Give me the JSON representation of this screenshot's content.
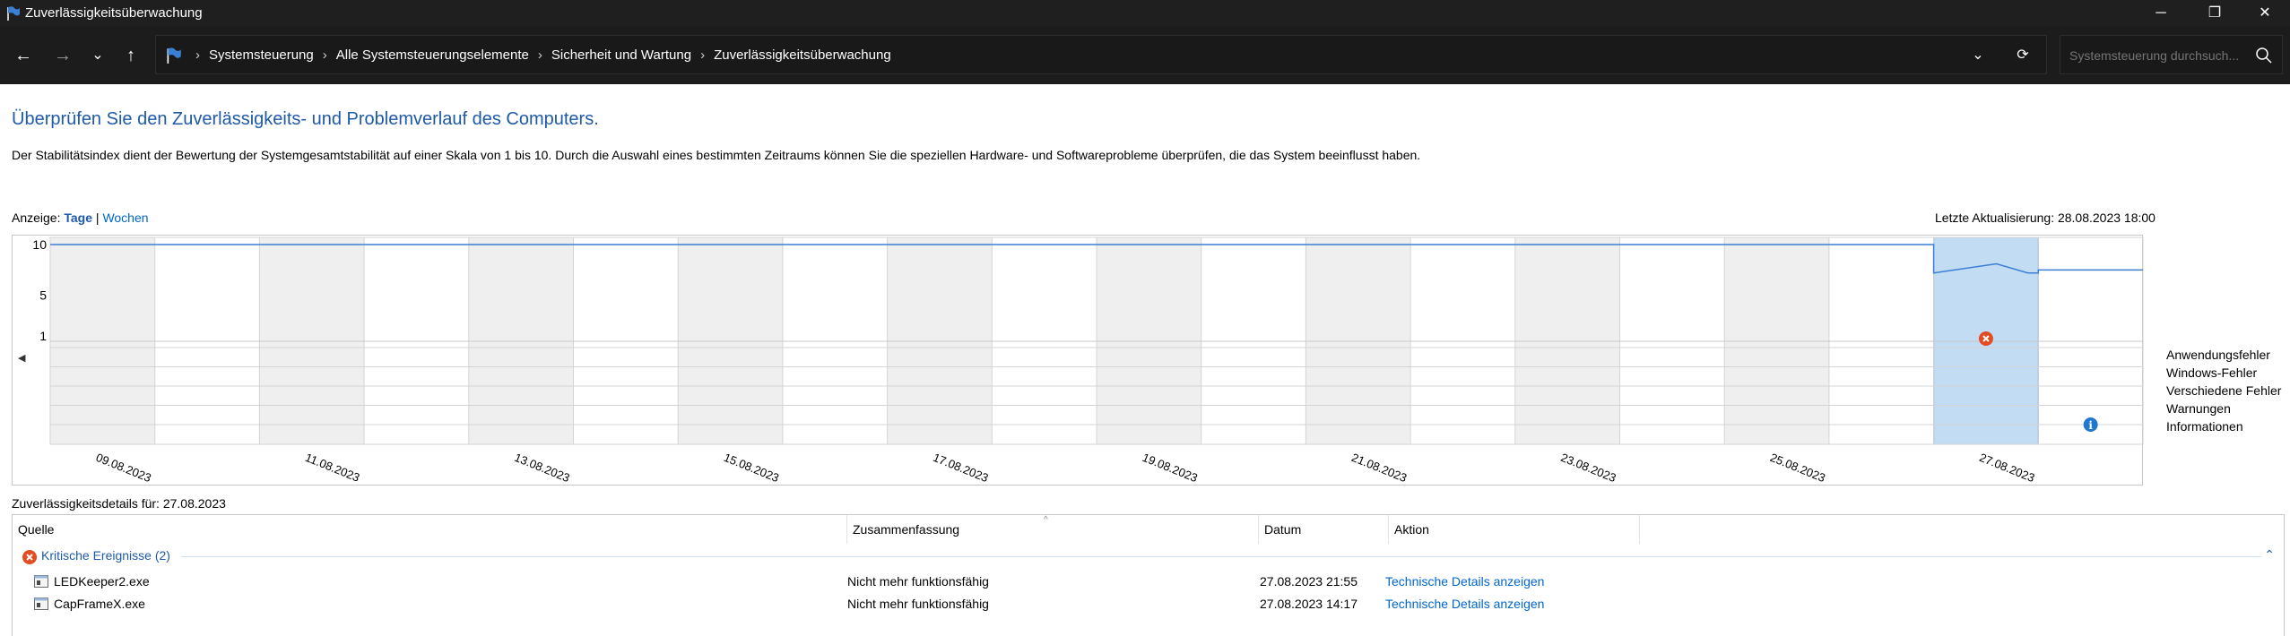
{
  "window": {
    "title": "Zuverlässigkeitsüberwachung",
    "controls": {
      "minimize": "─",
      "restore": "❐",
      "close": "✕"
    }
  },
  "nav": {
    "back": "←",
    "forward": "→",
    "recent": "⌄",
    "up": "↑",
    "breadcrumbs": [
      "Systemsteuerung",
      "Alle Systemsteuerungselemente",
      "Sicherheit und Wartung",
      "Zuverlässigkeitsüberwachung"
    ],
    "breadcrumb_separator": "›",
    "dropdown": "⌄",
    "refresh": "⟳",
    "search_placeholder": "Systemsteuerung durchsuch..."
  },
  "content": {
    "heading": "Überprüfen Sie den Zuverlässigkeits- und Problemverlauf des Computers.",
    "description": "Der Stabilitätsindex dient der Bewertung der Systemgesamtstabilität auf einer Skala von 1 bis 10. Durch die Auswahl eines bestimmten Zeitraums können Sie die speziellen Hardware- und Softwareprobleme überprüfen, die das System beeinflusst haben.",
    "view_label": "Anzeige:",
    "view_days": "Tage",
    "view_separator": "|",
    "view_weeks": "Wochen",
    "last_update": "Letzte Aktualisierung: 28.08.2023 18:00"
  },
  "chart_data": {
    "type": "line",
    "y_ticks": [
      "10",
      "5",
      "1"
    ],
    "ylim": [
      1,
      10
    ],
    "date_labels": [
      "09.08.2023",
      "11.08.2023",
      "13.08.2023",
      "15.08.2023",
      "17.08.2023",
      "19.08.2023",
      "21.08.2023",
      "23.08.2023",
      "25.08.2023",
      "27.08.2023"
    ],
    "columns": 20,
    "selected_column": 18,
    "stability_index": [
      10,
      10,
      10,
      10,
      10,
      10,
      10,
      10,
      10,
      10,
      10,
      10,
      10,
      10,
      10,
      10,
      10,
      10,
      7.2,
      7.5
    ],
    "event_rows": [
      "Anwendungsfehler",
      "Windows-Fehler",
      "Verschiedene Fehler",
      "Warnungen",
      "Informationen"
    ],
    "events": [
      {
        "column": 18,
        "row": "Anwendungsfehler",
        "kind": "error"
      },
      {
        "column": 19,
        "row": "Informationen",
        "kind": "info"
      }
    ],
    "colors": {
      "line": "#3b7fd4",
      "selected": "#c2dcf3",
      "error": "#e34b20",
      "info": "#1f77d0",
      "shade": "#efefef"
    }
  },
  "details": {
    "title": "Zuverlässigkeitsdetails für: 27.08.2023",
    "columns": [
      "Quelle",
      "Zusammenfassung",
      "Datum",
      "Aktion"
    ],
    "group_label": "Kritische Ereignisse (2)",
    "rows": [
      {
        "source": "LEDKeeper2.exe",
        "summary": "Nicht mehr funktionsfähig",
        "date": "27.08.2023 21:55",
        "action": "Technische Details anzeigen"
      },
      {
        "source": "CapFrameX.exe",
        "summary": "Nicht mehr funktionsfähig",
        "date": "27.08.2023 14:17",
        "action": "Technische Details anzeigen"
      }
    ]
  }
}
